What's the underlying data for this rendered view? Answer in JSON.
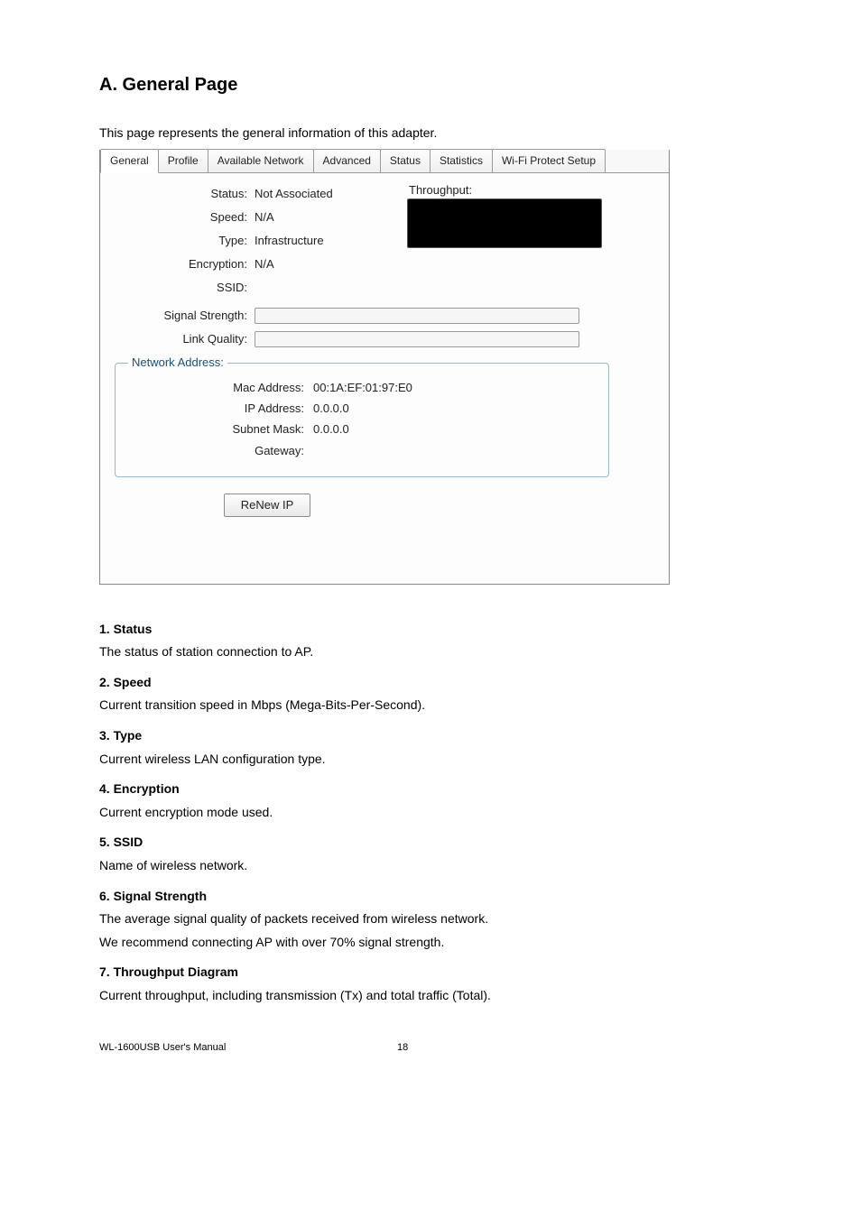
{
  "heading": "A. General Page",
  "intro": "This page represents the general information of this adapter.",
  "tabs": {
    "general": "General",
    "profile": "Profile",
    "available_network": "Available Network",
    "advanced": "Advanced",
    "status": "Status",
    "statistics": "Statistics",
    "wps": "Wi-Fi Protect Setup"
  },
  "labels": {
    "status": "Status:",
    "speed": "Speed:",
    "type": "Type:",
    "encryption": "Encryption:",
    "ssid": "SSID:",
    "signal_strength": "Signal Strength:",
    "link_quality": "Link Quality:",
    "throughput": "Throughput:"
  },
  "values": {
    "status": "Not Associated",
    "speed": "N/A",
    "type": "Infrastructure",
    "encryption": "N/A",
    "ssid": ""
  },
  "network_address": {
    "legend": "Network Address:",
    "mac_label": "Mac Address:",
    "mac_value": "00:1A:EF:01:97:E0",
    "ip_label": "IP Address:",
    "ip_value": "0.0.0.0",
    "subnet_label": "Subnet Mask:",
    "subnet_value": "0.0.0.0",
    "gateway_label": "Gateway:",
    "gateway_value": ""
  },
  "renew_btn": "ReNew IP",
  "defs": {
    "d1_t": "1. Status",
    "d1_b": "The status of station connection to AP.",
    "d2_t": "2. Speed",
    "d2_b": "Current transition speed in Mbps (Mega-Bits-Per-Second).",
    "d3_t": "3. Type",
    "d3_b": "Current wireless LAN configuration type.",
    "d4_t": "4. Encryption",
    "d4_b": "Current encryption mode used.",
    "d5_t": "5. SSID",
    "d5_b": "Name of wireless network.",
    "d6_t": "6. Signal Strength",
    "d6_b1": "The average signal quality of packets received from wireless network.",
    "d6_b2": "We recommend connecting AP with over 70% signal strength.",
    "d7_t": "7. Throughput Diagram",
    "d7_b": "Current throughput, including transmission (Tx) and total traffic (Total)."
  },
  "footer_left": "WL-1600USB User's Manual",
  "footer_page": "18"
}
